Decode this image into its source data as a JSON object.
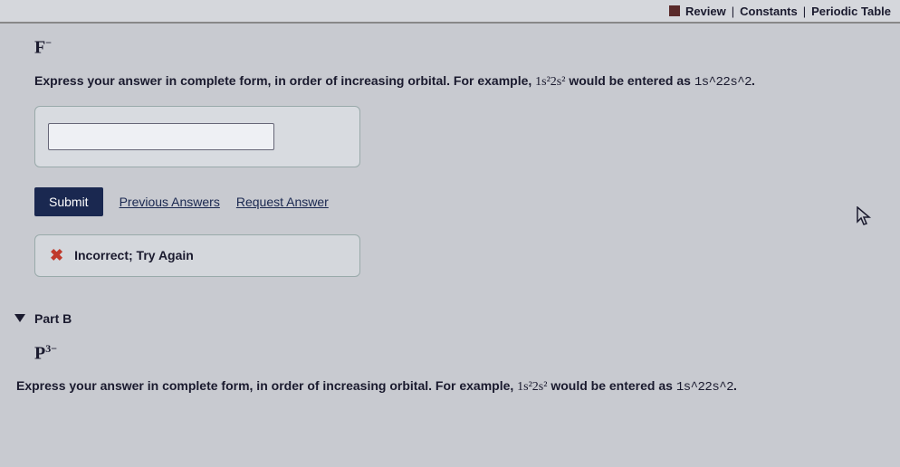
{
  "topbar": {
    "review": "Review",
    "constants": "Constants",
    "periodic": "Periodic Table"
  },
  "partA": {
    "species_base": "F",
    "species_charge": "−",
    "instruction_prefix": "Express your answer in complete form, in order of increasing orbital. For example, ",
    "example_math": "1s²2s²",
    "instruction_mid": " would be entered as ",
    "example_plain": "1s^22s^2",
    "instruction_suffix": ".",
    "input_value": "",
    "submit": "Submit",
    "prev_answers": "Previous Answers",
    "request_answer": "Request Answer",
    "feedback": "Incorrect; Try Again"
  },
  "partB": {
    "title": "Part B",
    "species_base": "P",
    "species_charge": "3−",
    "instruction_prefix": "Express your answer in complete form, in order of increasing orbital. For example, ",
    "example_math": "1s²2s²",
    "instruction_mid": " would be entered as ",
    "example_plain": "1s^22s^2",
    "instruction_suffix": "."
  }
}
